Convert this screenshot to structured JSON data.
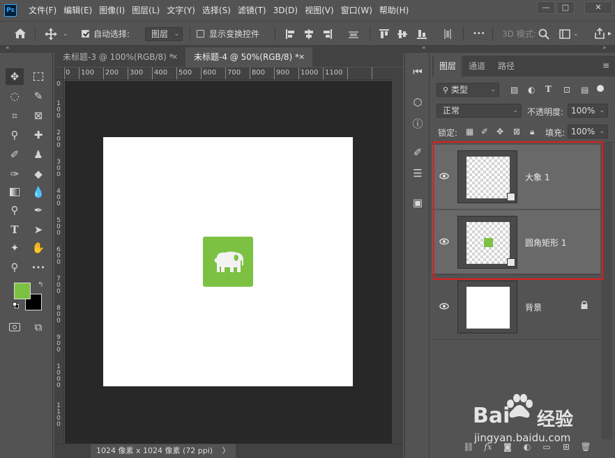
{
  "app": {
    "logo_text": "Ps",
    "menu": [
      "文件(F)",
      "编辑(E)",
      "图像(I)",
      "图层(L)",
      "文字(Y)",
      "选择(S)",
      "滤镜(T)",
      "3D(D)",
      "视图(V)",
      "窗口(W)",
      "帮助(H)"
    ]
  },
  "options": {
    "auto_select_label": "自动选择:",
    "auto_select_value": "图层",
    "show_transform_label": "显示变换控件",
    "mode_3d_label": "3D 模式:",
    "more_label": "•••"
  },
  "document": {
    "tabs": [
      {
        "label": "未标题-3 @ 100%(RGB/8) *",
        "close": "×"
      },
      {
        "label": "未标题-4 @ 50%(RGB/8) *",
        "close": "×"
      }
    ],
    "ruler_h": [
      "0",
      "100",
      "200",
      "300",
      "400",
      "500",
      "600",
      "700",
      "800",
      "900",
      "1000",
      "1100"
    ],
    "ruler_v": [
      "0",
      "1 0 0",
      "2 0 0",
      "3 0 0",
      "4 0 0",
      "5 0 0",
      "6 0 0",
      "7 0 0",
      "8 0 0",
      "9 0 0",
      "1 0 0 0",
      "1 1 0 0"
    ],
    "status": "1024 像素 x 1024 像素 (72 ppi)",
    "status_arrow": "〉"
  },
  "panel": {
    "tabs": [
      "图层",
      "通道",
      "路径"
    ],
    "filter_label": "类型",
    "blend_mode": "正常",
    "opacity_label": "不透明度:",
    "opacity_value": "100%",
    "lock_label": "锁定:",
    "fill_label": "填充:",
    "fill_value": "100%",
    "layers": [
      {
        "name": "大象 1",
        "kind": "smart"
      },
      {
        "name": "圆角矩形 1",
        "kind": "smart"
      },
      {
        "name": "背景",
        "kind": "background"
      }
    ]
  },
  "watermark": {
    "brand": "Bai",
    "brand_suffix": "经验",
    "url": "jingyan.baidu.com"
  },
  "colors": {
    "foreground": "#7dc143",
    "background": "#000000",
    "accent_highlight": "#e21b1b"
  }
}
